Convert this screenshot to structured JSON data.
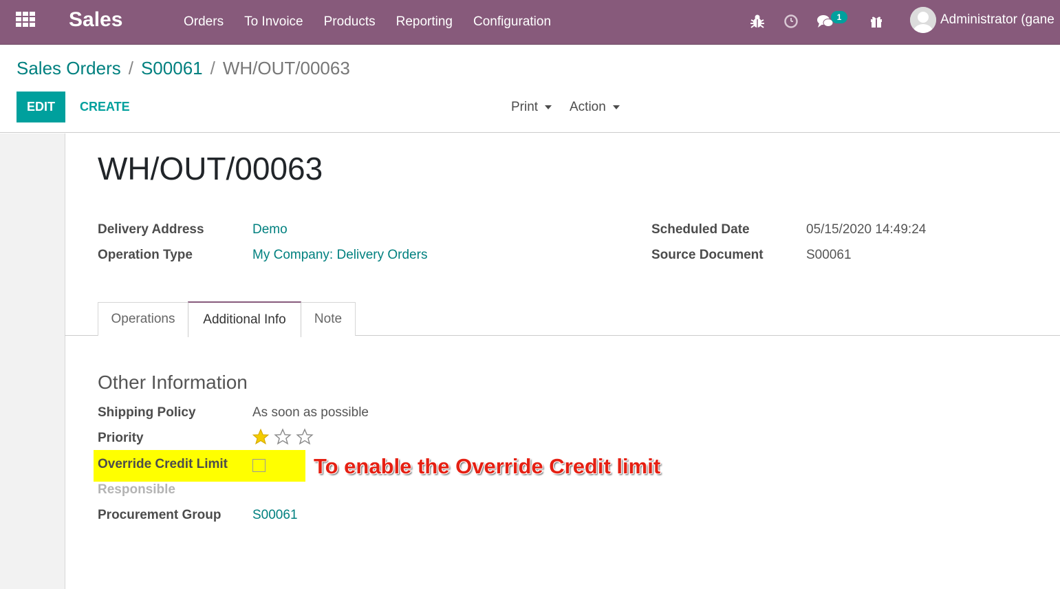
{
  "navbar": {
    "app_name": "Sales",
    "menu": [
      "Orders",
      "To Invoice",
      "Products",
      "Reporting",
      "Configuration"
    ],
    "messages_count": "1",
    "user_name": "Administrator (gane",
    "accent_color": "#875a7b"
  },
  "breadcrumb": {
    "items": [
      "Sales Orders",
      "S00061"
    ],
    "current": "WH/OUT/00063"
  },
  "controls": {
    "edit_label": "EDIT",
    "create_label": "CREATE",
    "print_label": "Print",
    "action_label": "Action"
  },
  "record": {
    "title": "WH/OUT/00063",
    "delivery_address_label": "Delivery Address",
    "delivery_address": "Demo",
    "operation_type_label": "Operation Type",
    "operation_type": "My Company: Delivery Orders",
    "scheduled_date_label": "Scheduled Date",
    "scheduled_date": "05/15/2020 14:49:24",
    "source_document_label": "Source Document",
    "source_document": "S00061"
  },
  "tabs": {
    "items": [
      "Operations",
      "Additional Info",
      "Note"
    ],
    "active": "Additional Info"
  },
  "other_info": {
    "title": "Other Information",
    "shipping_policy_label": "Shipping Policy",
    "shipping_policy": "As soon as possible",
    "priority_label": "Priority",
    "priority_stars_filled": 1,
    "priority_stars_total": 3,
    "override_label": "Override Credit Limit",
    "override_checked": false,
    "responsible_label": "Responsible",
    "procurement_group_label": "Procurement Group",
    "procurement_group": "S00061"
  },
  "annotation": {
    "text": "To enable the Override Credit limit"
  }
}
